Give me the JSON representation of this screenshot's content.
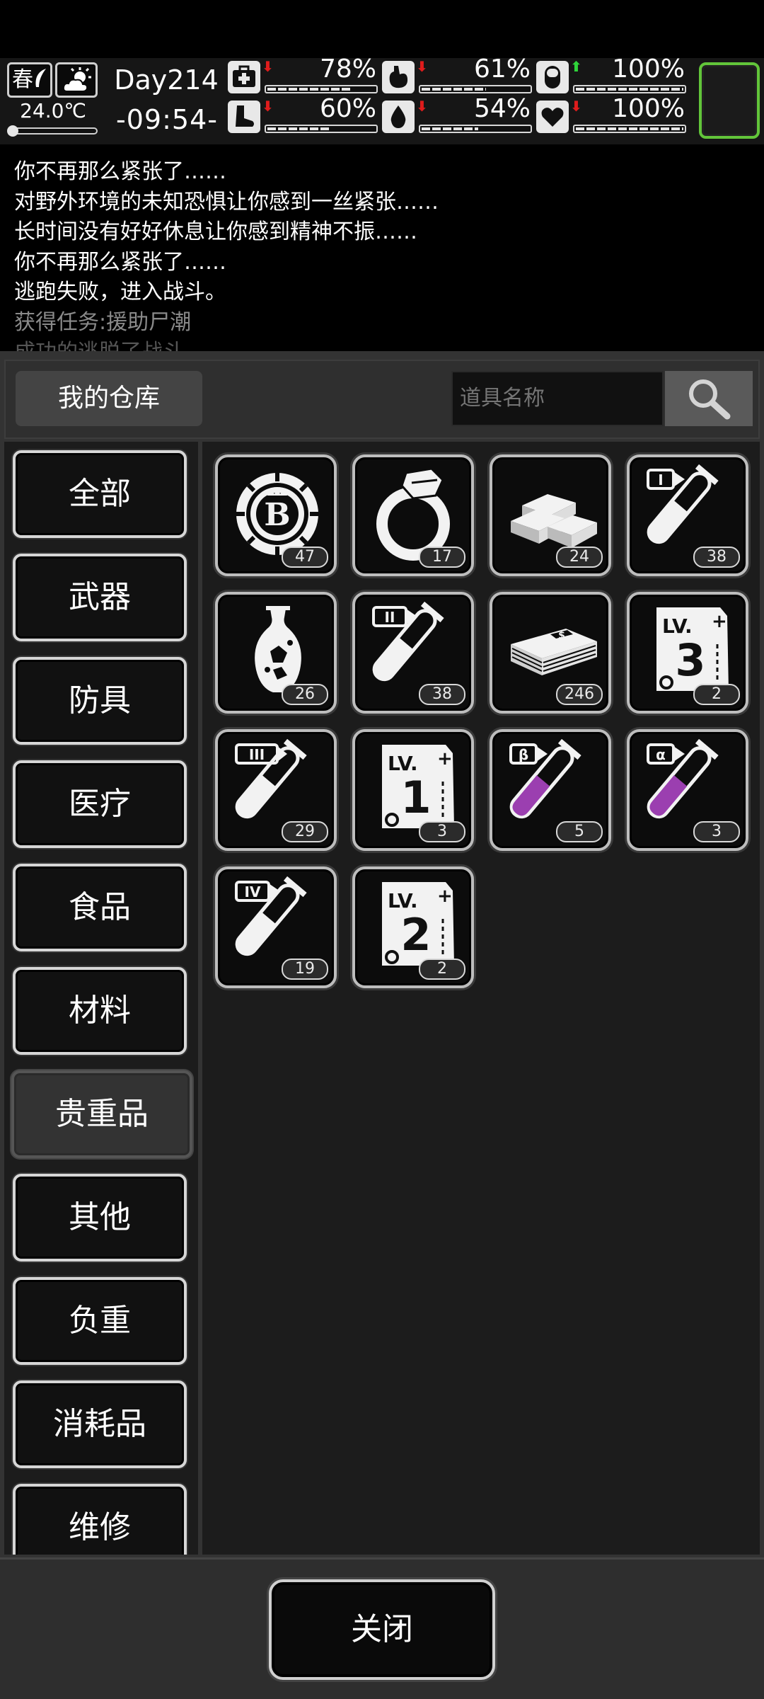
{
  "status": {
    "season": "春",
    "temperature": "24.0℃",
    "temperature_level": 0.05,
    "day": "Day214",
    "time": "-09:54-",
    "stats": [
      {
        "name": "health",
        "icon": "medkit-icon",
        "arrow": "down",
        "value": "78%",
        "level": 0.78
      },
      {
        "name": "hunger",
        "icon": "stomach-icon",
        "arrow": "down",
        "value": "61%",
        "level": 0.61
      },
      {
        "name": "sanity",
        "icon": "pill-icon",
        "arrow": "up",
        "value": "100%",
        "level": 1.0
      },
      {
        "name": "stamina",
        "icon": "foot-icon",
        "arrow": "down",
        "value": "60%",
        "level": 0.6
      },
      {
        "name": "thirst",
        "icon": "water-drop-icon",
        "arrow": "down",
        "value": "54%",
        "level": 0.54
      },
      {
        "name": "mood",
        "icon": "heart-icon",
        "arrow": "down",
        "value": "100%",
        "level": 1.0
      }
    ],
    "colors": {
      "down_arrow": "#e01c1c",
      "up_arrow": "#2fd43a",
      "accent_border": "#62c53a"
    }
  },
  "log": [
    "你不再那么紧张了……",
    "对野外环境的未知恐惧让你感到一丝紧张……",
    "长时间没有好好休息让你感到精神不振……",
    "你不再那么紧张了……",
    "逃跑失败，进入战斗。",
    "获得任务:援助尸潮",
    "成功的逃脱了战斗"
  ],
  "warehouse": {
    "title": "我的仓库",
    "search_placeholder": "道具名称",
    "categories": [
      "全部",
      "武器",
      "防具",
      "医疗",
      "食品",
      "材料",
      "贵重品",
      "其他",
      "负重",
      "消耗品",
      "维修"
    ],
    "active_category": "贵重品",
    "items": [
      {
        "icon": "coin-chip-icon",
        "qty": "47"
      },
      {
        "icon": "ring-icon",
        "qty": "17"
      },
      {
        "icon": "gold-bars-icon",
        "qty": "24"
      },
      {
        "icon": "test-tube-i-icon",
        "qty": "38"
      },
      {
        "icon": "vase-icon",
        "qty": "26"
      },
      {
        "icon": "test-tube-ii-icon",
        "qty": "38"
      },
      {
        "icon": "cash-stack-icon",
        "qty": "246"
      },
      {
        "icon": "skill-book-lv3-icon",
        "qty": "2"
      },
      {
        "icon": "test-tube-iii-icon",
        "qty": "29"
      },
      {
        "icon": "skill-book-lv1-icon",
        "qty": "3"
      },
      {
        "icon": "test-tube-beta-icon",
        "qty": "5"
      },
      {
        "icon": "test-tube-alpha-icon",
        "qty": "3"
      },
      {
        "icon": "test-tube-iv-icon",
        "qty": "19"
      },
      {
        "icon": "skill-book-lv2-icon",
        "qty": "2"
      }
    ],
    "item_glyphs": {
      "coin": "B",
      "tube_i": "I",
      "tube_ii": "II",
      "tube_iii": "III",
      "tube_iv": "IV",
      "tube_beta": "β",
      "tube_alpha": "α",
      "book_prefix": "LV.",
      "book_lv1": "1",
      "book_lv2": "2",
      "book_lv3": "3"
    },
    "close_label": "关闭"
  }
}
